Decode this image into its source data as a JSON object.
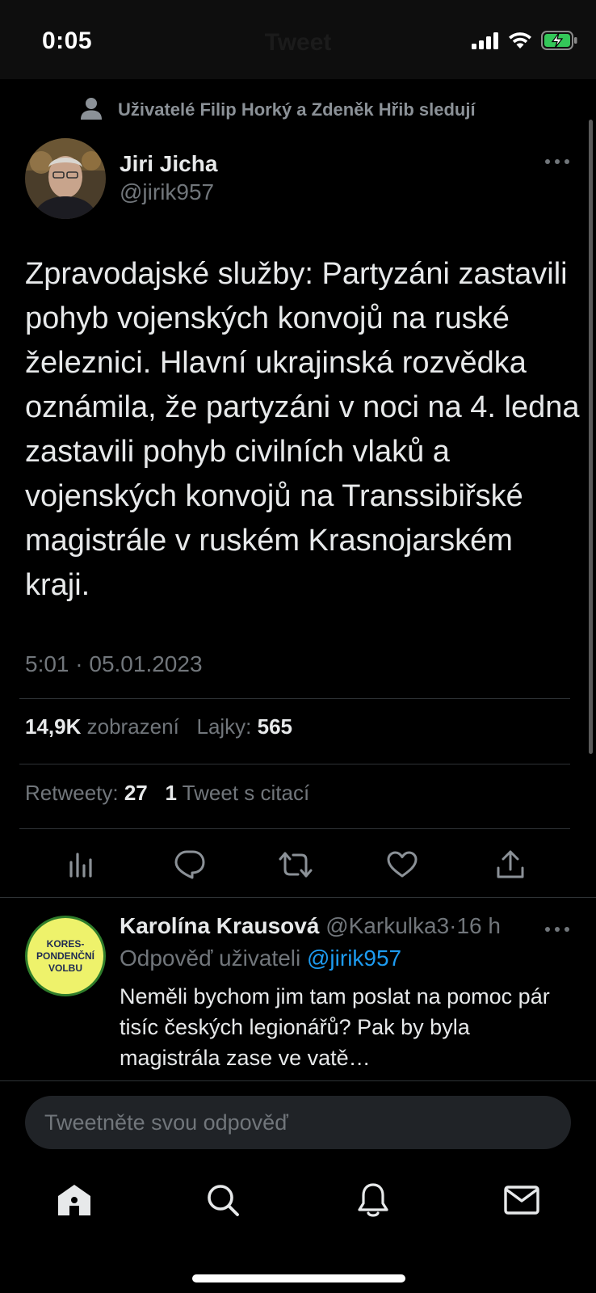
{
  "status_bar": {
    "time": "0:05",
    "ghost_title": "Tweet",
    "battery_charging": true
  },
  "social_context": "Uživatelé Filip Horký a Zdeněk Hřib sledují",
  "author": {
    "name": "Jiri Jicha",
    "handle": "@jirik957"
  },
  "tweet": {
    "text": "Zpravodajské služby:  Partyzáni zastavili pohyb vojenských konvojů na ruské železnici. Hlavní ukrajinská rozvědka oznámila, že partyzáni v noci na 4. ledna zastavili pohyb civilních vlaků a vojenských konvojů na Transsibiřské magistrále v ruském Krasnojarském kraji.",
    "timestamp": "5:01 · 05.01.2023"
  },
  "stats": {
    "views_count": "14,9K",
    "views_label": "zobrazení",
    "likes_label": "Lajky:",
    "likes_count": "565",
    "retweets_label": "Retweety:",
    "retweets_count": "27",
    "quotes_count": "1",
    "quotes_label": "Tweet s citací"
  },
  "actions": [
    "analytics-icon",
    "reply-icon",
    "retweet-icon",
    "like-icon",
    "share-icon"
  ],
  "reply": {
    "avatar_text": "KORES-\nPONDENČNÍ\nVOLBU",
    "name": "Karolína Krausová",
    "handle": "@Karkulka3",
    "separator": "·",
    "time": "16 h",
    "reply_to_label": "Odpověď uživateli",
    "reply_to_handle": "@jirik957",
    "text": "Neměli bychom jim tam poslat na pomoc pár tisíc českých legionářů? Pak by byla magistrála zase ve vatě…"
  },
  "compose": {
    "placeholder": "Tweetněte svou odpověď"
  },
  "tabbar": [
    "home-icon",
    "search-icon",
    "notifications-icon",
    "messages-icon"
  ],
  "colors": {
    "accent": "#1d9bf0",
    "battery": "#34c759",
    "background": "#000000",
    "secondary_text": "#71767b"
  }
}
